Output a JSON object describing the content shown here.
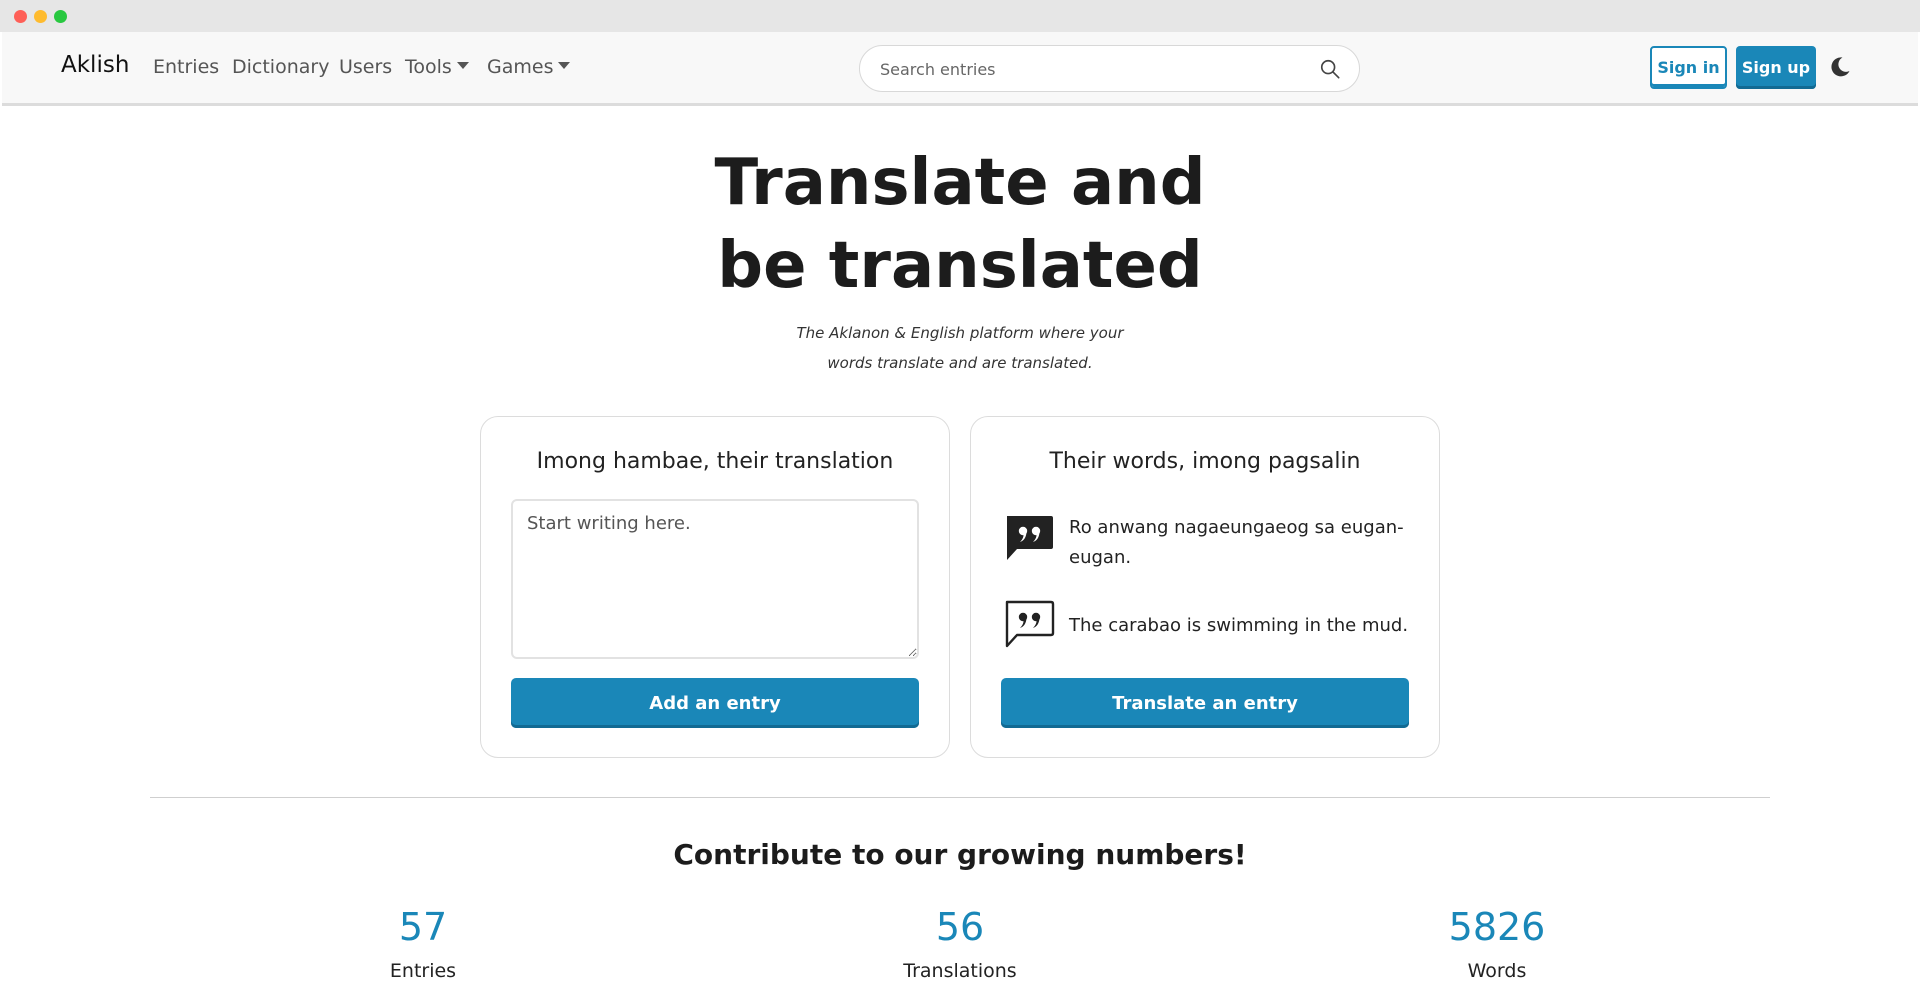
{
  "nav": {
    "brand": "Aklish",
    "links": [
      "Entries",
      "Dictionary",
      "Users"
    ],
    "tools": "Tools",
    "games": "Games",
    "search_placeholder": "Search entries",
    "signin": "Sign in",
    "signup": "Sign up",
    "theme_icon": "moon-icon"
  },
  "hero": {
    "title_line1": "Translate and",
    "title_line2": "be translated",
    "sub_line1": "The Aklanon & English platform where your",
    "sub_line2": "words translate and are translated."
  },
  "card_left": {
    "title": "Imong hambae, their translation",
    "textarea_placeholder": "Start writing here.",
    "button": "Add an entry"
  },
  "card_right": {
    "title": "Their words, imong pagsalin",
    "quote1": "Ro anwang nagaeungaeog sa eugan-eugan.",
    "quote2": "The carabao is swimming in the mud.",
    "button": "Translate an entry"
  },
  "stats": {
    "title": "Contribute to our growing numbers!",
    "items": [
      {
        "value": "57",
        "label": "Entries"
      },
      {
        "value": "56",
        "label": "Translations"
      },
      {
        "value": "5826",
        "label": "Words"
      }
    ]
  },
  "colors": {
    "accent": "#1a87b8"
  }
}
